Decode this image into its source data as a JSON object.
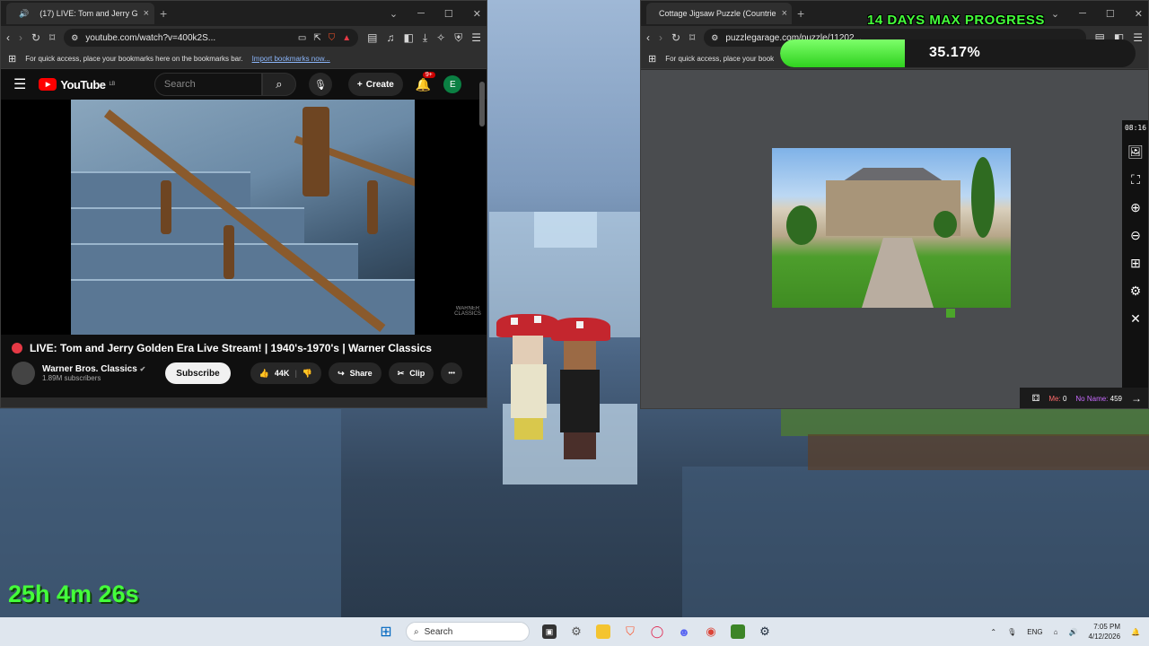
{
  "overlay": {
    "progress_title": "14 DAYS MAX PROGRESS",
    "progress_percent_label": "35.17%",
    "progress_fraction": 0.3517,
    "stream_timer": "25h 4m 26s"
  },
  "youtube_window": {
    "tab": {
      "title": "(17) LIVE: Tom and Jerry G",
      "close": "×",
      "new_tab": "+"
    },
    "window_controls": {
      "dropdown": "⌄",
      "minimize": "─",
      "maximize": "☐",
      "close": "✕"
    },
    "address": "youtube.com/watch?v=400k2S...",
    "bookmark_hint": "For quick access, place your bookmarks here on the bookmarks bar.",
    "bookmark_import": "Import bookmarks now...",
    "yt": {
      "logo": "YouTube",
      "region": "LB",
      "search_placeholder": "Search",
      "create_label": "Create",
      "notification_count": "9+",
      "avatar_letter": "E"
    },
    "video": {
      "watermark": "WARNER CLASSICS",
      "title": "LIVE: Tom and Jerry Golden Era Live Stream! | 1940's-1970's | Warner Classics",
      "channel": "Warner Bros. Classics",
      "subscribers": "1.89M subscribers",
      "subscribe_label": "Subscribe",
      "like_count": "44K",
      "share_label": "Share",
      "clip_label": "Clip",
      "more_label": "•••"
    }
  },
  "puzzle_window": {
    "tab": {
      "title": "Cottage Jigsaw Puzzle (Countrie",
      "close": "×",
      "new_tab": "+"
    },
    "window_controls": {
      "dropdown": "⌄",
      "minimize": "─",
      "maximize": "☐",
      "close": "✕"
    },
    "address": "puzzlegarage.com/puzzle/11202...",
    "bookmark_hint": "For quick access, place your book",
    "timer": "08:16",
    "score": {
      "me_label": "Me:",
      "me_value": "0",
      "noname_label": "No Name:",
      "noname_value": "459"
    }
  },
  "taskbar": {
    "search_placeholder": "Search",
    "language": "ENG",
    "time": "7:05 PM",
    "date": "4/12/2026"
  },
  "colors": {
    "accent_green": "#44ff3a",
    "youtube_red": "#ff0000",
    "me_color": "#ff6b6b",
    "noname_color": "#c86bff"
  }
}
